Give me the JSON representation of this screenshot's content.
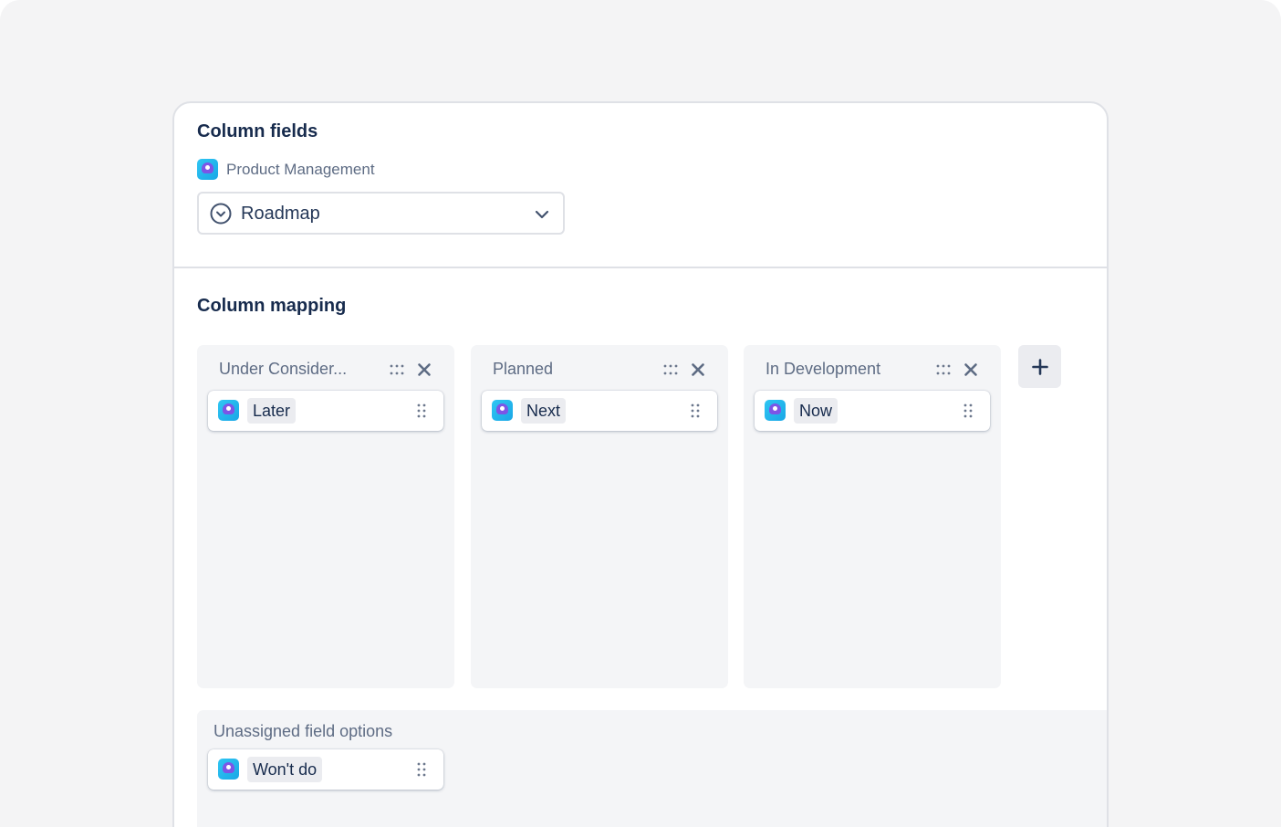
{
  "column_fields": {
    "title": "Column fields",
    "source": {
      "label": "Product Management",
      "icon": "product-app-icon"
    },
    "select": {
      "value": "Roadmap",
      "icon": "select-field-icon",
      "chevron": "chevron-down-icon"
    }
  },
  "column_mapping": {
    "title": "Column mapping",
    "columns": [
      {
        "name": "Under Consider...",
        "cards": [
          {
            "label": "Later"
          }
        ]
      },
      {
        "name": "Planned",
        "cards": [
          {
            "label": "Next"
          }
        ]
      },
      {
        "name": "In Development",
        "cards": [
          {
            "label": "Now"
          }
        ]
      }
    ],
    "add_button": {
      "label": "+",
      "icon": "plus-icon"
    }
  },
  "unassigned": {
    "title": "Unassigned field options",
    "cards": [
      {
        "label": "Won't do"
      }
    ]
  },
  "colors": {
    "background": "#f4f4f5",
    "panel": "#ffffff",
    "column_bg": "#f4f5f7",
    "chip_bg": "#ebecf0",
    "text_dark": "#172b4d",
    "text_muted": "#5e6c84",
    "app_icon": "#1aa7e6"
  }
}
